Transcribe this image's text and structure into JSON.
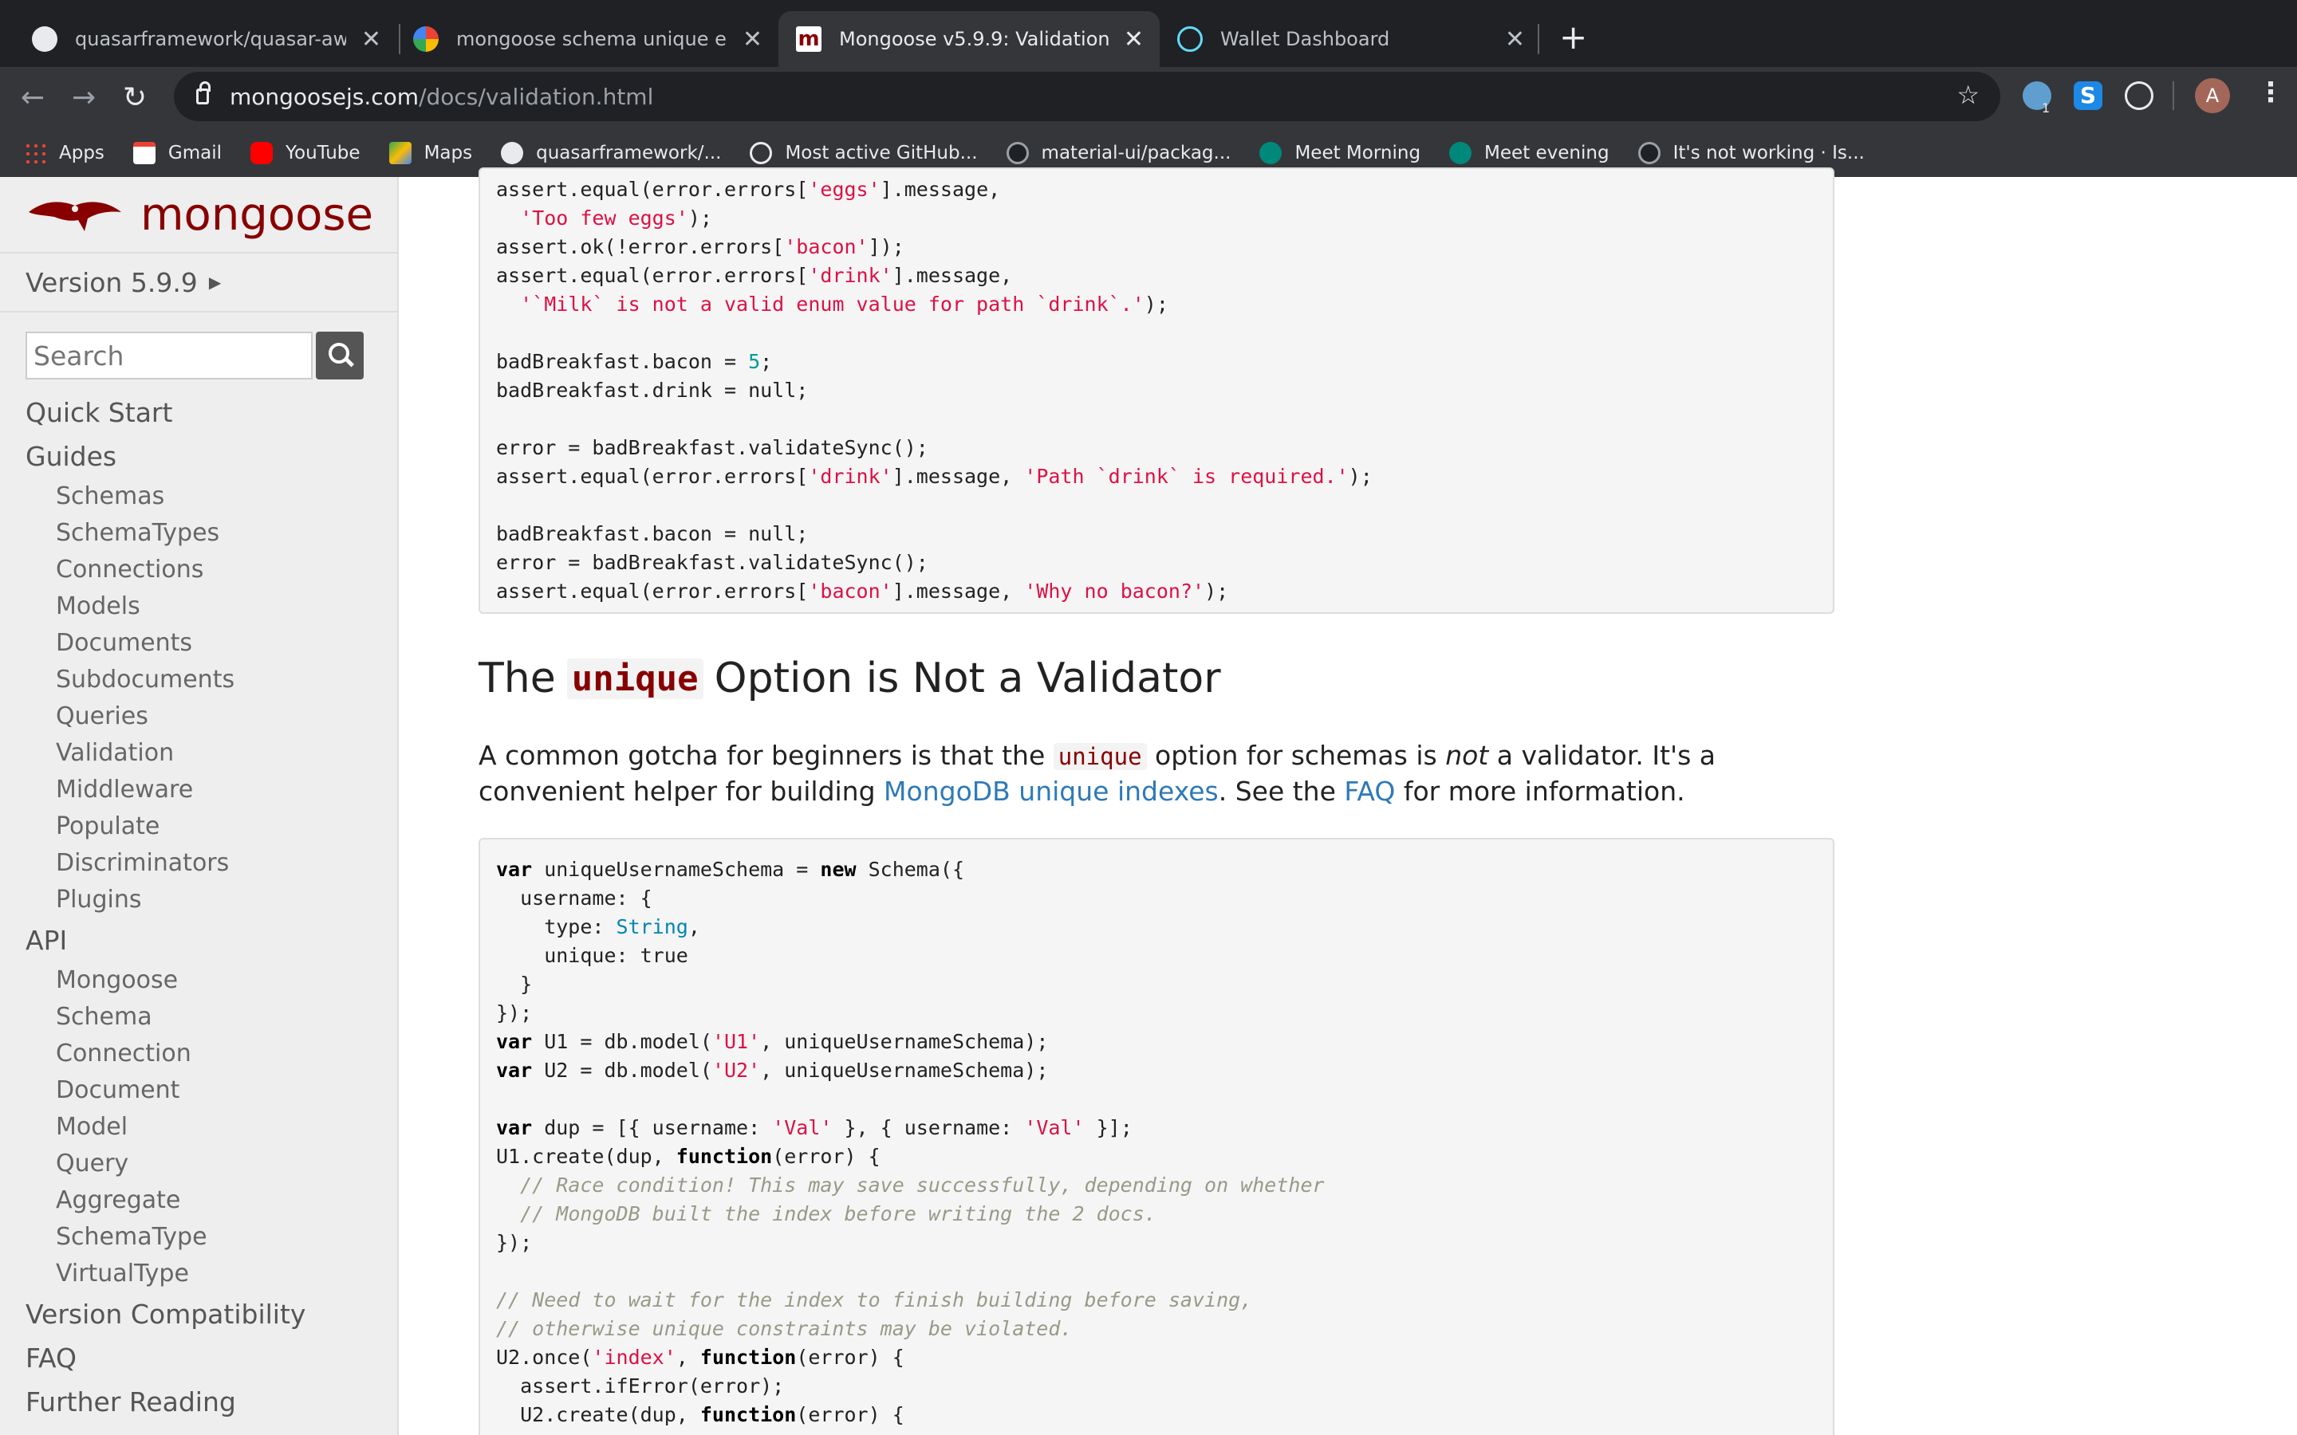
{
  "tabs": [
    {
      "title": "quasarframework/quasar-aweso",
      "favicon": "github-icon"
    },
    {
      "title": "mongoose schema unique error",
      "favicon": "google-icon"
    },
    {
      "title": "Mongoose v5.9.9: Validation",
      "favicon": "mongoose-icon"
    },
    {
      "title": "Wallet Dashboard",
      "favicon": "react-icon"
    }
  ],
  "address": {
    "host": "mongoosejs.com",
    "path": "/docs/validation.html"
  },
  "extensions": {
    "badge": "1"
  },
  "profile": {
    "initial": "A"
  },
  "bookmarks": [
    {
      "label": "Apps"
    },
    {
      "label": "Gmail"
    },
    {
      "label": "YouTube"
    },
    {
      "label": "Maps"
    },
    {
      "label": "quasarframework/..."
    },
    {
      "label": "Most active GitHub..."
    },
    {
      "label": "material-ui/packag..."
    },
    {
      "label": "Meet Morning"
    },
    {
      "label": "Meet evening"
    },
    {
      "label": "It's not working · Is..."
    }
  ],
  "sidebar": {
    "logo": "mongoose",
    "version": "Version 5.9.9",
    "search_placeholder": "Search",
    "nav": [
      {
        "label": "Quick Start",
        "level": "top"
      },
      {
        "label": "Guides",
        "level": "top"
      },
      {
        "label": "Schemas",
        "level": "sub"
      },
      {
        "label": "SchemaTypes",
        "level": "sub"
      },
      {
        "label": "Connections",
        "level": "sub"
      },
      {
        "label": "Models",
        "level": "sub"
      },
      {
        "label": "Documents",
        "level": "sub"
      },
      {
        "label": "Subdocuments",
        "level": "sub"
      },
      {
        "label": "Queries",
        "level": "sub"
      },
      {
        "label": "Validation",
        "level": "sub"
      },
      {
        "label": "Middleware",
        "level": "sub"
      },
      {
        "label": "Populate",
        "level": "sub"
      },
      {
        "label": "Discriminators",
        "level": "sub"
      },
      {
        "label": "Plugins",
        "level": "sub"
      },
      {
        "label": "API",
        "level": "top"
      },
      {
        "label": "Mongoose",
        "level": "sub"
      },
      {
        "label": "Schema",
        "level": "sub"
      },
      {
        "label": "Connection",
        "level": "sub"
      },
      {
        "label": "Document",
        "level": "sub"
      },
      {
        "label": "Model",
        "level": "sub"
      },
      {
        "label": "Query",
        "level": "sub"
      },
      {
        "label": "Aggregate",
        "level": "sub"
      },
      {
        "label": "SchemaType",
        "level": "sub"
      },
      {
        "label": "VirtualType",
        "level": "sub"
      },
      {
        "label": "Version Compatibility",
        "level": "top"
      },
      {
        "label": "FAQ",
        "level": "top"
      },
      {
        "label": "Further Reading",
        "level": "top"
      }
    ]
  },
  "content": {
    "heading": {
      "before": "The",
      "code": "unique",
      "after": "Option is Not a Validator"
    },
    "para": {
      "p1": "A common gotcha for beginners is that the",
      "code": "unique",
      "p2": "option for schemas is",
      "em": "not",
      "p3": "a validator. It's a convenient helper for building",
      "link1": "MongoDB unique indexes",
      "p4": ". See the",
      "link2": "FAQ",
      "p5": "for more information."
    },
    "code1": [
      [
        [
          "assert.equal(error.errors[",
          ""
        ],
        [
          "'eggs'",
          "s"
        ],
        [
          "].message,",
          ""
        ]
      ],
      [
        [
          "  ",
          ""
        ],
        [
          "'Too few eggs'",
          "s"
        ],
        [
          ");",
          ""
        ]
      ],
      [
        [
          "assert.ok(!error.errors[",
          ""
        ],
        [
          "'bacon'",
          "s"
        ],
        [
          "]);",
          ""
        ]
      ],
      [
        [
          "assert.equal(error.errors[",
          ""
        ],
        [
          "'drink'",
          "s"
        ],
        [
          "].message,",
          ""
        ]
      ],
      [
        [
          "  ",
          ""
        ],
        [
          "'`Milk` is not a valid enum value for path `drink`.'",
          "s"
        ],
        [
          ");",
          ""
        ]
      ],
      [],
      [
        [
          "badBreakfast.bacon = ",
          ""
        ],
        [
          "5",
          "n"
        ],
        [
          ";",
          ""
        ]
      ],
      [
        [
          "badBreakfast.drink = null;",
          ""
        ]
      ],
      [],
      [
        [
          "error = badBreakfast.validateSync();",
          ""
        ]
      ],
      [
        [
          "assert.equal(error.errors[",
          ""
        ],
        [
          "'drink'",
          "s"
        ],
        [
          "].message, ",
          ""
        ],
        [
          "'Path `drink` is required.'",
          "s"
        ],
        [
          ");",
          ""
        ]
      ],
      [],
      [
        [
          "badBreakfast.bacon = null;",
          ""
        ]
      ],
      [
        [
          "error = badBreakfast.validateSync();",
          ""
        ]
      ],
      [
        [
          "assert.equal(error.errors[",
          ""
        ],
        [
          "'bacon'",
          "s"
        ],
        [
          "].message, ",
          ""
        ],
        [
          "'Why no bacon?'",
          "s"
        ],
        [
          ");",
          ""
        ]
      ]
    ],
    "code2": [
      [
        [
          "var",
          "k"
        ],
        [
          " uniqueUsernameSchema = ",
          ""
        ],
        [
          "new",
          "k"
        ],
        [
          " Schema({",
          ""
        ]
      ],
      [
        [
          "  username: {",
          ""
        ]
      ],
      [
        [
          "    type: ",
          ""
        ],
        [
          "String",
          "t"
        ],
        [
          ",",
          ""
        ]
      ],
      [
        [
          "    unique: true",
          ""
        ]
      ],
      [
        [
          "  }",
          ""
        ]
      ],
      [
        [
          "});",
          ""
        ]
      ],
      [
        [
          "var",
          "k"
        ],
        [
          " U1 = db.model(",
          ""
        ],
        [
          "'U1'",
          "s"
        ],
        [
          ", uniqueUsernameSchema);",
          ""
        ]
      ],
      [
        [
          "var",
          "k"
        ],
        [
          " U2 = db.model(",
          ""
        ],
        [
          "'U2'",
          "s"
        ],
        [
          ", uniqueUsernameSchema);",
          ""
        ]
      ],
      [],
      [
        [
          "var",
          "k"
        ],
        [
          " dup = [{ username: ",
          ""
        ],
        [
          "'Val'",
          "s"
        ],
        [
          " }, { username: ",
          ""
        ],
        [
          "'Val'",
          "s"
        ],
        [
          " }];",
          ""
        ]
      ],
      [
        [
          "U1.create(dup, ",
          ""
        ],
        [
          "function",
          "k"
        ],
        [
          "(error) {",
          ""
        ]
      ],
      [
        [
          "  ",
          ""
        ],
        [
          "// Race condition! This may save successfully, depending on whether",
          "c"
        ]
      ],
      [
        [
          "  ",
          ""
        ],
        [
          "// MongoDB built the index before writing the 2 docs.",
          "c"
        ]
      ],
      [
        [
          "});",
          ""
        ]
      ],
      [],
      [
        [
          "// Need to wait for the index to finish building before saving,",
          "c"
        ]
      ],
      [
        [
          "// otherwise unique constraints may be violated.",
          "c"
        ]
      ],
      [
        [
          "U2.once(",
          ""
        ],
        [
          "'index'",
          "s"
        ],
        [
          ", ",
          ""
        ],
        [
          "function",
          "k"
        ],
        [
          "(error) {",
          ""
        ]
      ],
      [
        [
          "  assert.ifError(error);",
          ""
        ]
      ],
      [
        [
          "  U2.create(dup, ",
          ""
        ],
        [
          "function",
          "k"
        ],
        [
          "(error) {",
          ""
        ]
      ]
    ]
  }
}
